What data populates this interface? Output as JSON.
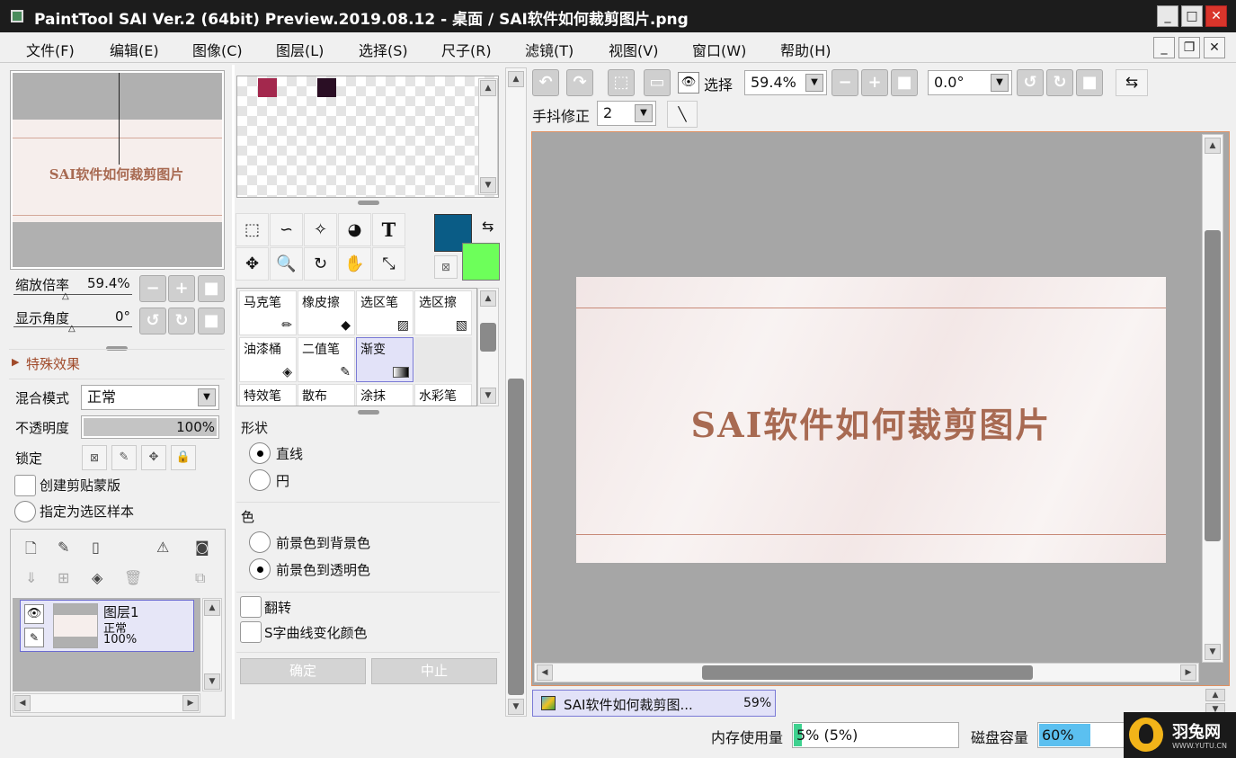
{
  "window": {
    "title": "PaintTool SAI Ver.2 (64bit) Preview.2019.08.12 - 桌面 / SAI软件如何裁剪图片.png"
  },
  "menu": [
    "文件(F)",
    "编辑(E)",
    "图像(C)",
    "图层(L)",
    "选择(S)",
    "尺子(R)",
    "滤镜(T)",
    "视图(V)",
    "窗口(W)",
    "帮助(H)"
  ],
  "navigator": {
    "zoom_label": "缩放倍率",
    "zoom_value": "59.4%",
    "angle_label": "显示角度",
    "angle_value": "0°",
    "preview_text": "SAI软件如何裁剪图片"
  },
  "effects": {
    "label": "特殊效果"
  },
  "layer_props": {
    "blend_label": "混合模式",
    "blend_value": "正常",
    "opacity_label": "不透明度",
    "opacity_value": "100%",
    "opacity": 1.0,
    "lock_label": "锁定",
    "clip_label": "创建剪贴蒙版",
    "sample_label": "指定为选区样本"
  },
  "layers": [
    {
      "name": "图层1",
      "mode": "正常",
      "opacity": "100%"
    }
  ],
  "colors": {
    "fg": "#0a5c86",
    "bg": "#6dff5a",
    "swatch1": "#a3284d",
    "swatch2": "#2a0e24",
    "brand": "#a86a52"
  },
  "brushes": [
    {
      "label": "马克笔"
    },
    {
      "label": "橡皮擦"
    },
    {
      "label": "选区笔"
    },
    {
      "label": "选区擦"
    },
    {
      "label": "油漆桶"
    },
    {
      "label": "二值笔"
    },
    {
      "label": "渐变"
    },
    {
      "label": ""
    },
    {
      "label": "特效笔"
    },
    {
      "label": "散布"
    },
    {
      "label": "涂抹"
    },
    {
      "label": "水彩笔"
    }
  ],
  "gradient": {
    "shape_label": "形状",
    "shape_line": "直线",
    "shape_circle": "円",
    "color_label": "色",
    "color_fg_bg": "前景色到背景色",
    "color_fg_trans": "前景色到透明色",
    "flip_label": "翻转",
    "scurve_label": "S字曲线变化颜色",
    "ok_label": "确定",
    "cancel_label": "中止"
  },
  "toolbar": {
    "select_label": "选择",
    "zoom_value": "59.4%",
    "rotation_value": "0.0°",
    "stabilizer_label": "手抖修正",
    "stabilizer_value": "2"
  },
  "canvas": {
    "text": "SAI软件如何裁剪图片"
  },
  "tab": {
    "name": "SAI软件如何裁剪图...",
    "zoom": "59%"
  },
  "status": {
    "memory_label": "内存使用量",
    "memory_value": "5% (5%)",
    "memory_pct": 0.05,
    "disk_label": "磁盘容量",
    "disk_value": "60%",
    "disk_pct": 0.6
  },
  "watermark": {
    "brand": "羽兔网",
    "url": "WWW.YUTU.CN"
  }
}
